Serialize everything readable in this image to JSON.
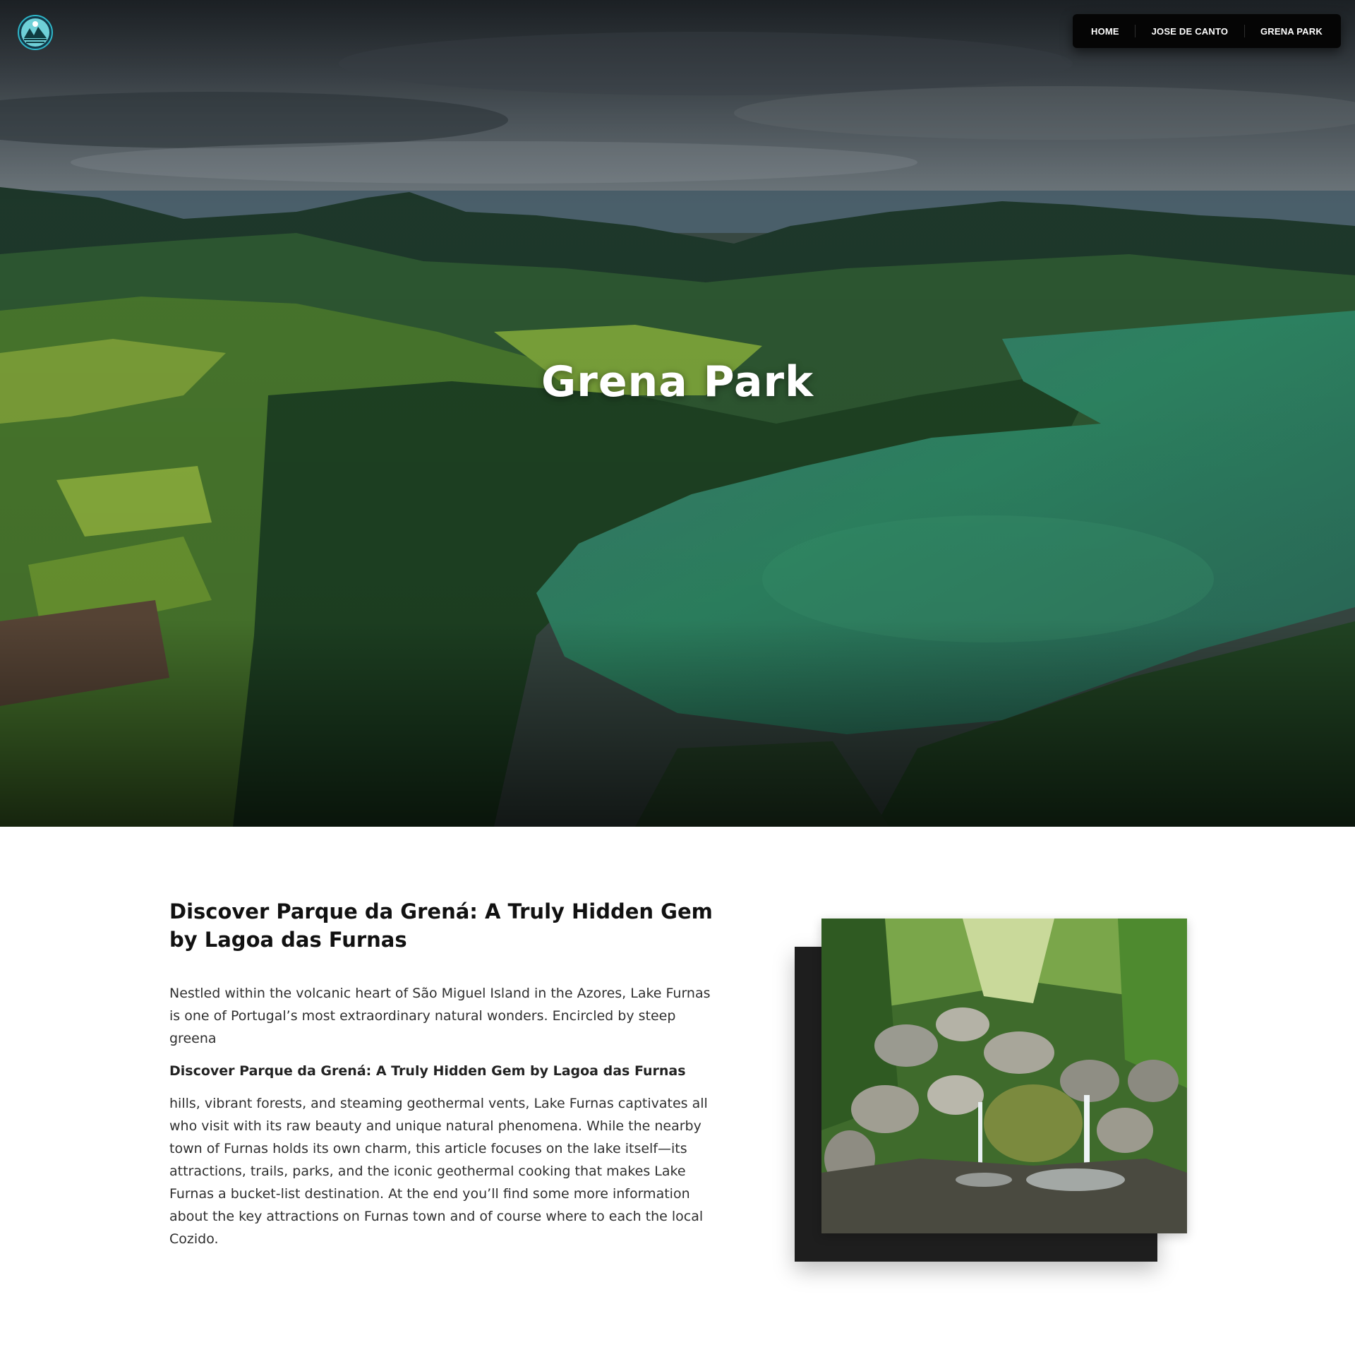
{
  "header": {
    "logo_icon": "lake-mountain-logo-icon",
    "nav": [
      {
        "label": "HOME"
      },
      {
        "label": "JOSE DE CANTO"
      },
      {
        "label": "GRENA PARK"
      }
    ]
  },
  "hero": {
    "title": "Grena Park",
    "image": "aerial-lake-furnas-photo"
  },
  "article": {
    "headline": "Discover Parque da Grená: A Truly Hidden Gem by Lagoa das Furnas",
    "intro": "Nestled within the volcanic heart of São Miguel Island in the Azores, Lake Furnas is one of Portugal’s most extraordinary natural wonders. Encircled by steep greena",
    "subheading": "Discover Parque da Grená: A Truly Hidden Gem by Lagoa das Furnas",
    "body": "hills, vibrant forests, and steaming geothermal vents, Lake Furnas captivates all who visit with its raw beauty and unique natural phenomena. While the nearby town of Furnas holds its own charm, this article focuses on the lake itself—its attractions, trails, parks, and the iconic geothermal cooking that makes Lake Furnas a bucket-list destination. At the end you’ll find some more information about the key attractions on Furnas town and of course where to each the local Cozido.",
    "photo": "waterfall-stream-photo"
  },
  "colors": {
    "nav_bg": "#050505",
    "hero_water": "#2f7a62",
    "text": "#2f2f2f"
  }
}
